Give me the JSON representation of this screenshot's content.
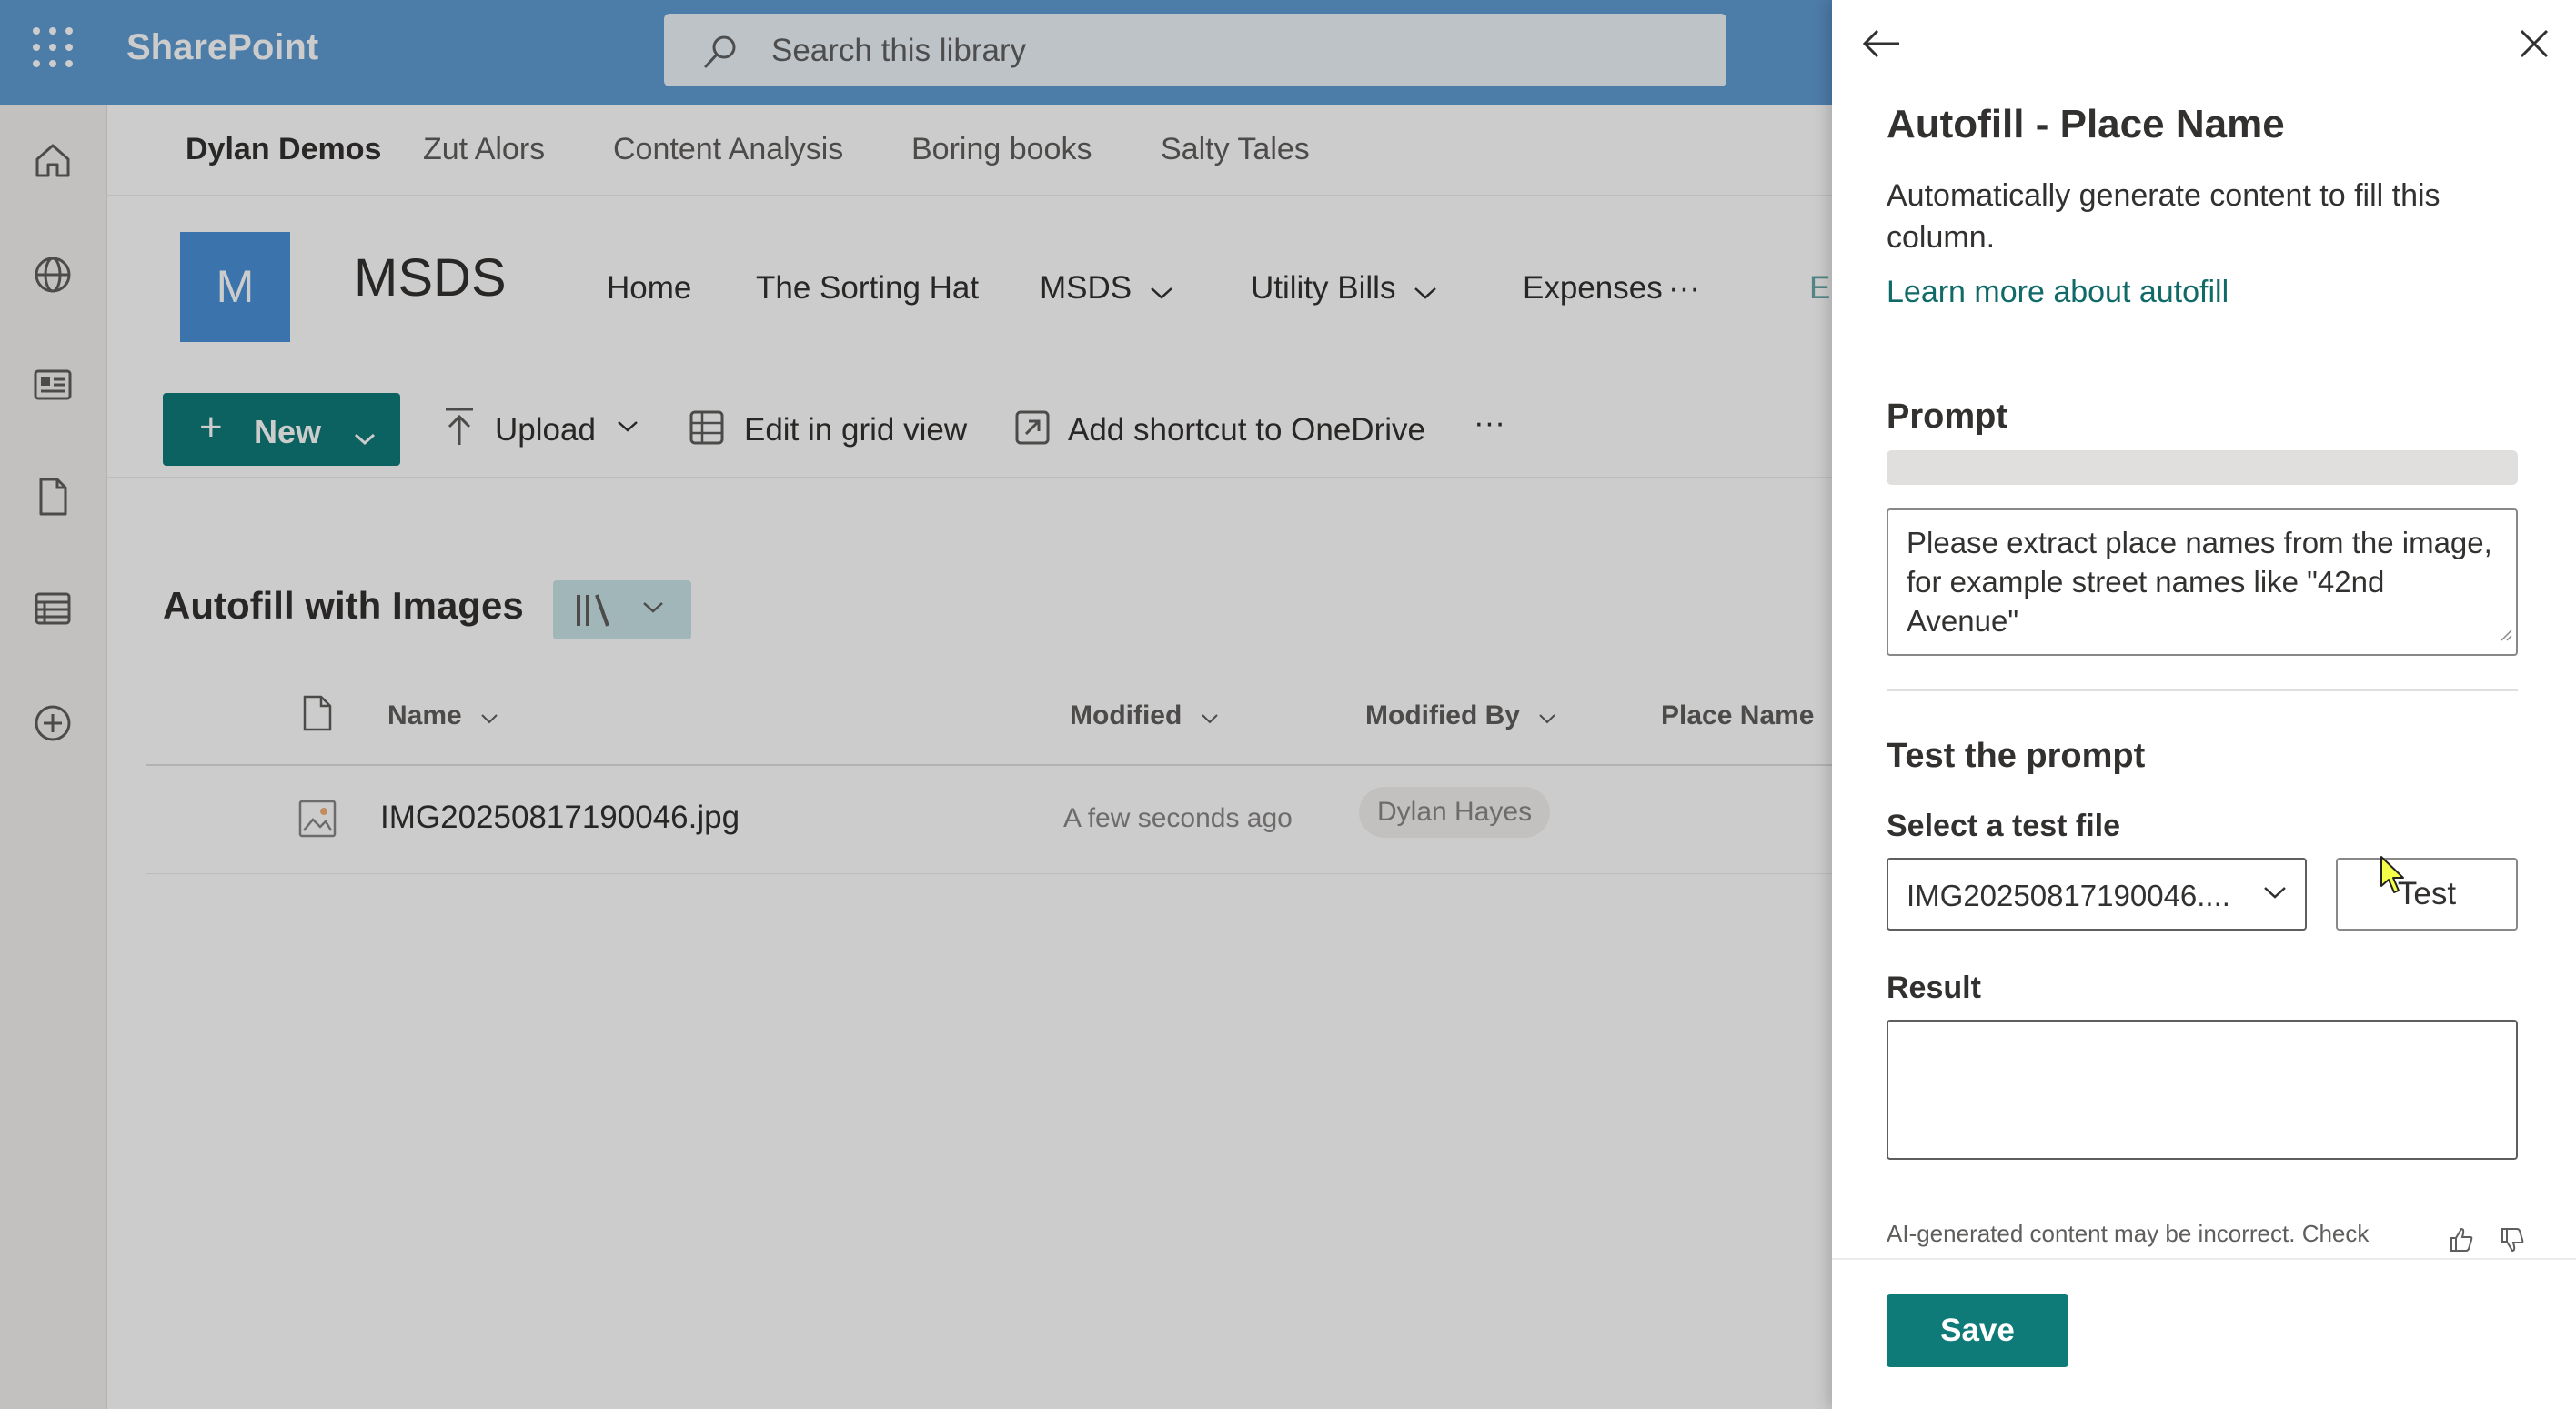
{
  "suite_bar": {
    "app_name": "SharePoint",
    "search_placeholder": "Search this library"
  },
  "hub_nav": [
    "Dylan Demos",
    "Zut Alors",
    "Content Analysis",
    "Boring books",
    "Salty Tales"
  ],
  "site": {
    "logo_letter": "M",
    "title": "MSDS",
    "nav": [
      "Home",
      "The Sorting Hat",
      "MSDS",
      "Utility Bills",
      "Expenses",
      "···",
      "E"
    ]
  },
  "command_bar": {
    "new": "New",
    "upload": "Upload",
    "edit_grid": "Edit in grid view",
    "add_shortcut": "Add shortcut to OneDrive",
    "more": "···"
  },
  "library": {
    "title": "Autofill with Images",
    "columns": [
      "Name",
      "Modified",
      "Modified By",
      "Place Name"
    ],
    "rows": [
      {
        "name": "IMG20250817190046.jpg",
        "modified": "A few seconds ago",
        "modified_by": "Dylan Hayes",
        "place_name": ""
      }
    ]
  },
  "panel": {
    "title": "Autofill - Place Name",
    "description": "Automatically generate content to fill this column.",
    "learn_more": "Learn more about autofill",
    "prompt_heading": "Prompt",
    "prompt_text": "Please extract place names from the image, for example street names like \"42nd Avenue\"",
    "test_heading": "Test the prompt",
    "select_label": "Select a test file",
    "selected_file": "IMG20250817190046....",
    "test_button": "Test",
    "result_label": "Result",
    "result_value": "",
    "disclaimer": "AI-generated content may be incorrect. Check",
    "save_button": "Save"
  },
  "colors": {
    "suite_bar": "#5f9bd3",
    "accent": "#0f7b79",
    "link": "#0f6a68"
  }
}
